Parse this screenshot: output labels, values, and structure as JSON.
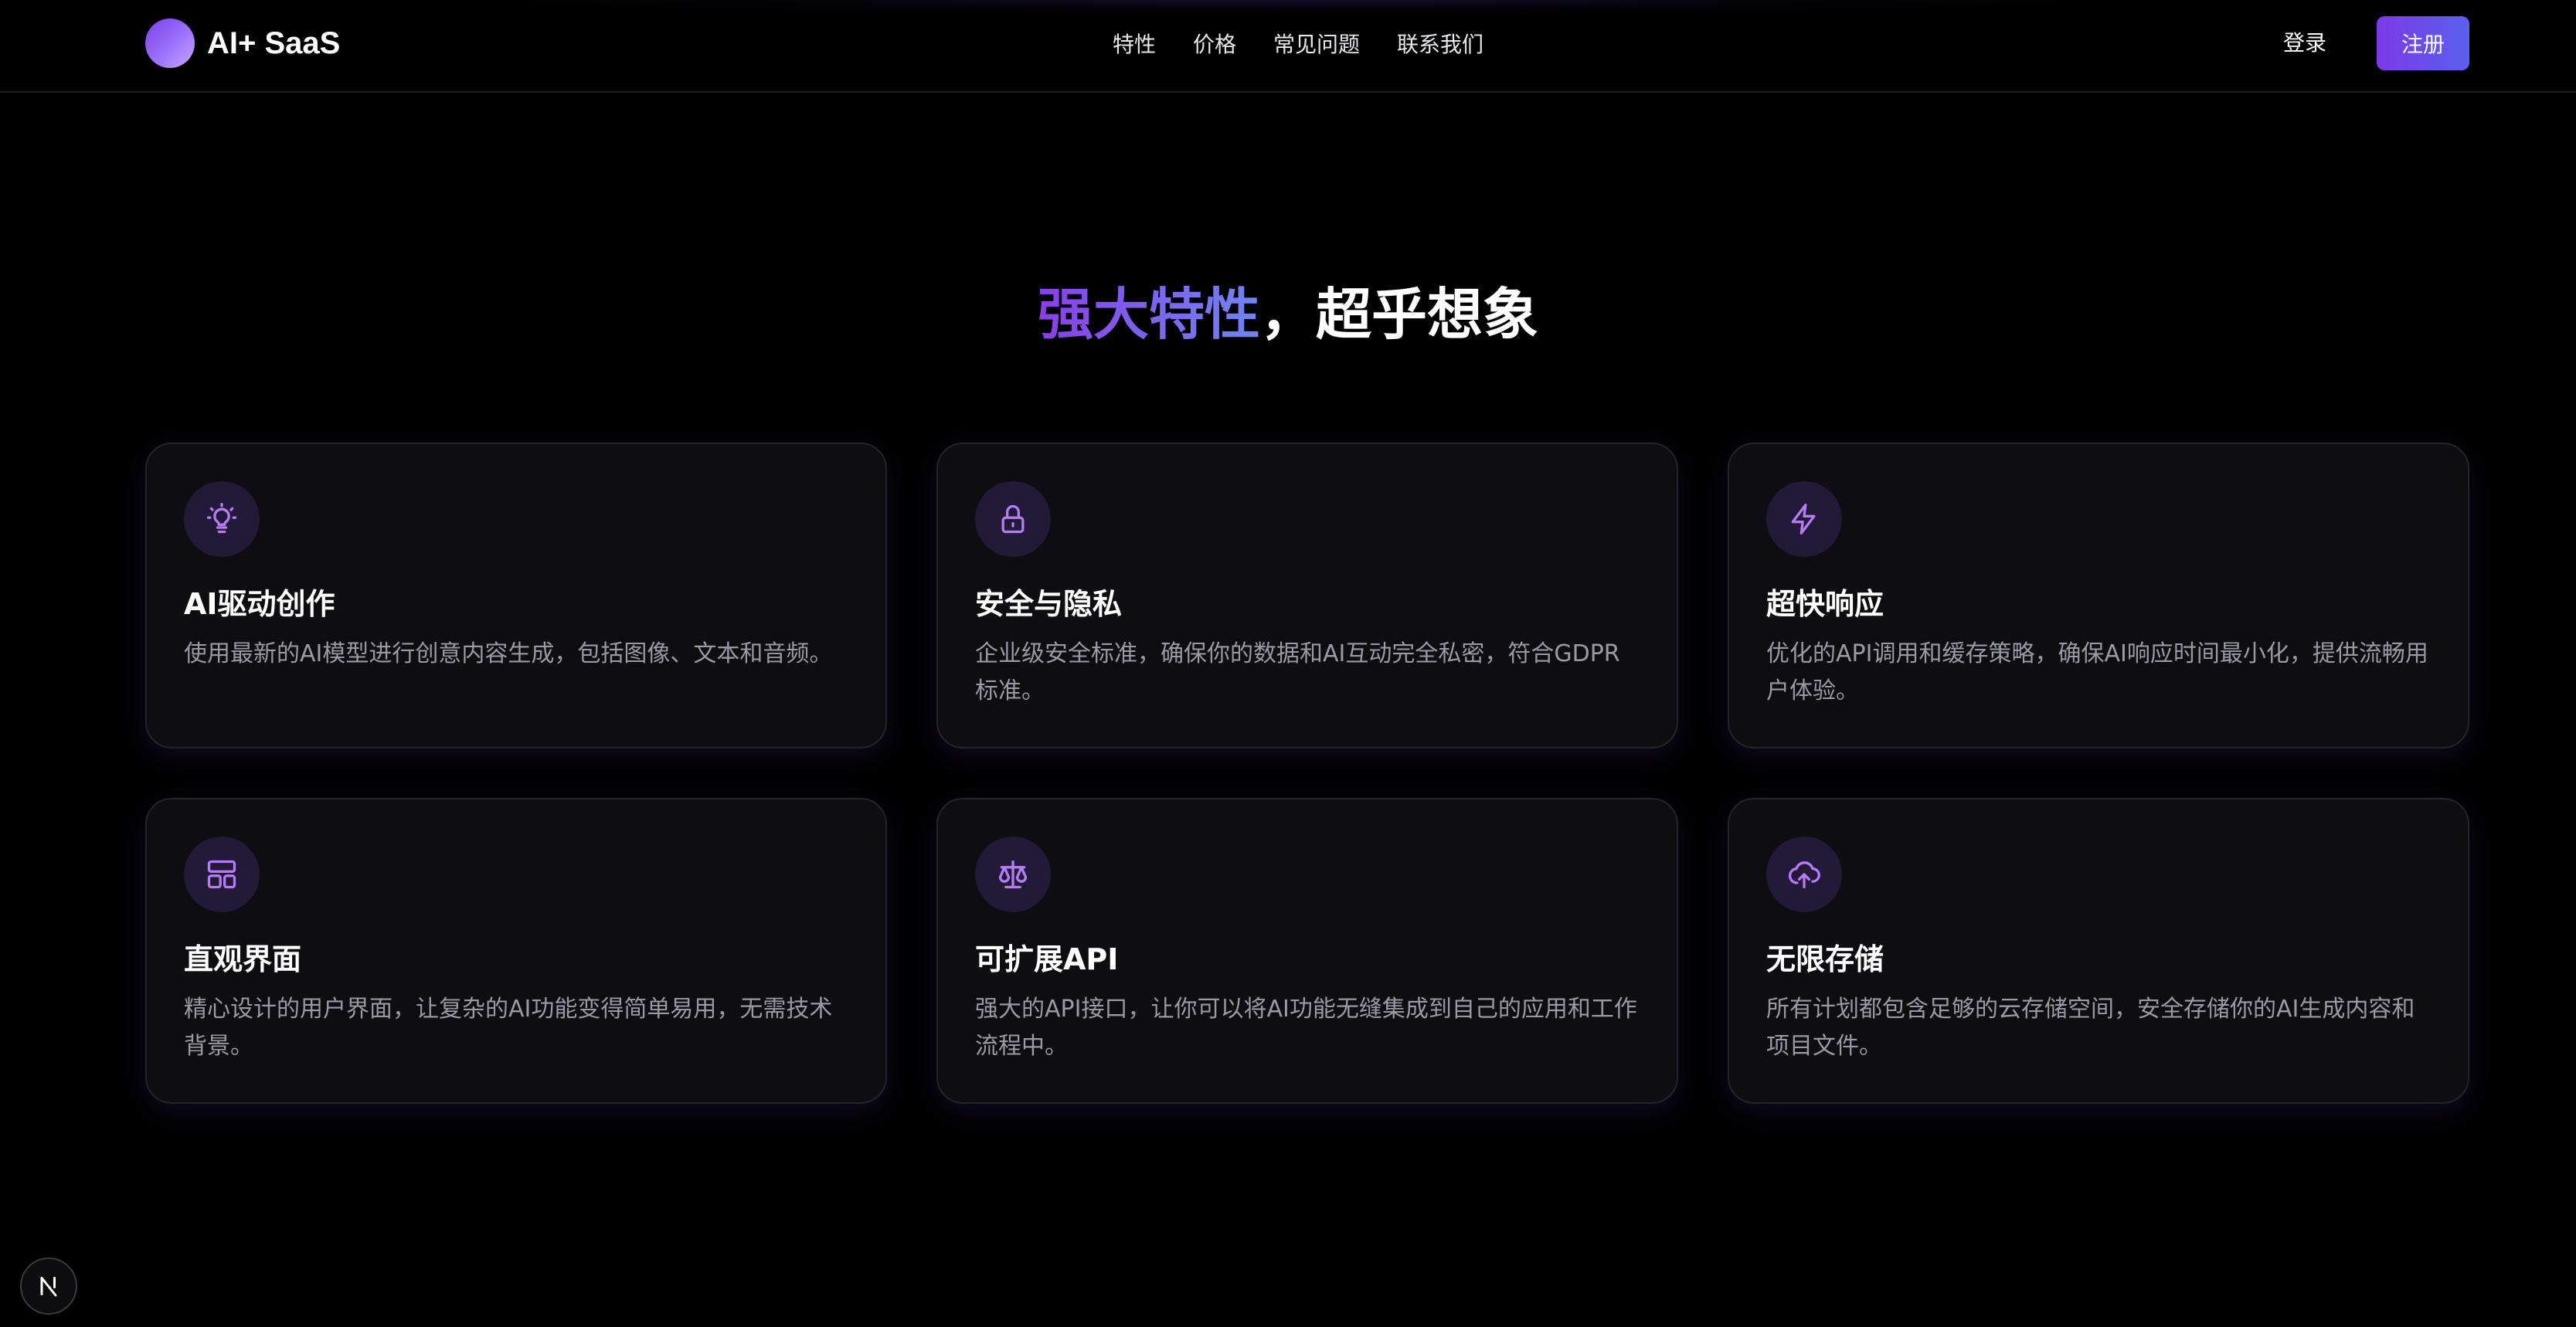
{
  "header": {
    "brand": "AI+ SaaS",
    "nav": [
      "特性",
      "价格",
      "常见问题",
      "联系我们"
    ],
    "login_label": "登录",
    "signup_label": "注册"
  },
  "section": {
    "title_accent": "强大特性",
    "title_rest": "，超乎想象"
  },
  "features": [
    {
      "icon": "lightbulb-icon",
      "title": "AI驱动创作",
      "description": "使用最新的AI模型进行创意内容生成，包括图像、文本和音频。"
    },
    {
      "icon": "lock-icon",
      "title": "安全与隐私",
      "description": "企业级安全标准，确保你的数据和AI互动完全私密，符合GDPR标准。"
    },
    {
      "icon": "lightning-icon",
      "title": "超快响应",
      "description": "优化的API调用和缓存策略，确保AI响应时间最小化，提供流畅用户体验。"
    },
    {
      "icon": "layout-icon",
      "title": "直观界面",
      "description": "精心设计的用户界面，让复杂的AI功能变得简单易用，无需技术背景。"
    },
    {
      "icon": "scale-icon",
      "title": "可扩展API",
      "description": "强大的API接口，让你可以将AI功能无缝集成到自己的应用和工作流程中。"
    },
    {
      "icon": "cloud-upload-icon",
      "title": "无限存储",
      "description": "所有计划都包含足够的云存储空间，安全存储你的AI生成内容和项目文件。"
    }
  ],
  "colors": {
    "background": "#000000",
    "card_background": "#0e0e12",
    "accent_purple": "#7a3ae6",
    "accent_blue": "#6f86f2",
    "icon_color": "#b57cf5"
  },
  "badge": "N"
}
